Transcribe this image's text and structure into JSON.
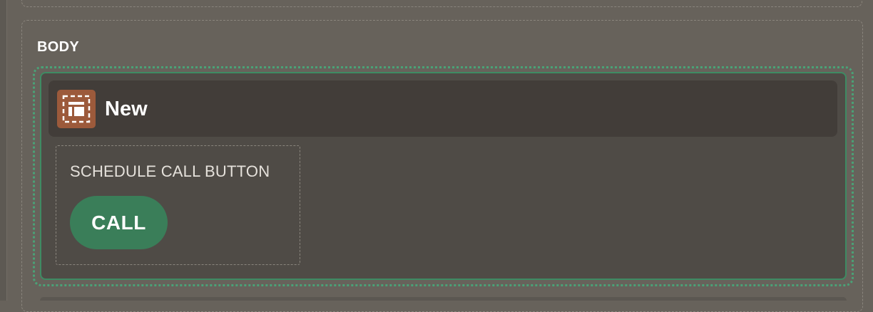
{
  "sections": {
    "body_label": "BODY"
  },
  "region": {
    "title": "New",
    "icon": "region-layout-icon",
    "accent_color": "#9c5a3b",
    "focus_color": "#4aa277"
  },
  "item": {
    "label": "SCHEDULE CALL BUTTON",
    "button_label": "CALL",
    "button_color": "#3a7e59"
  }
}
